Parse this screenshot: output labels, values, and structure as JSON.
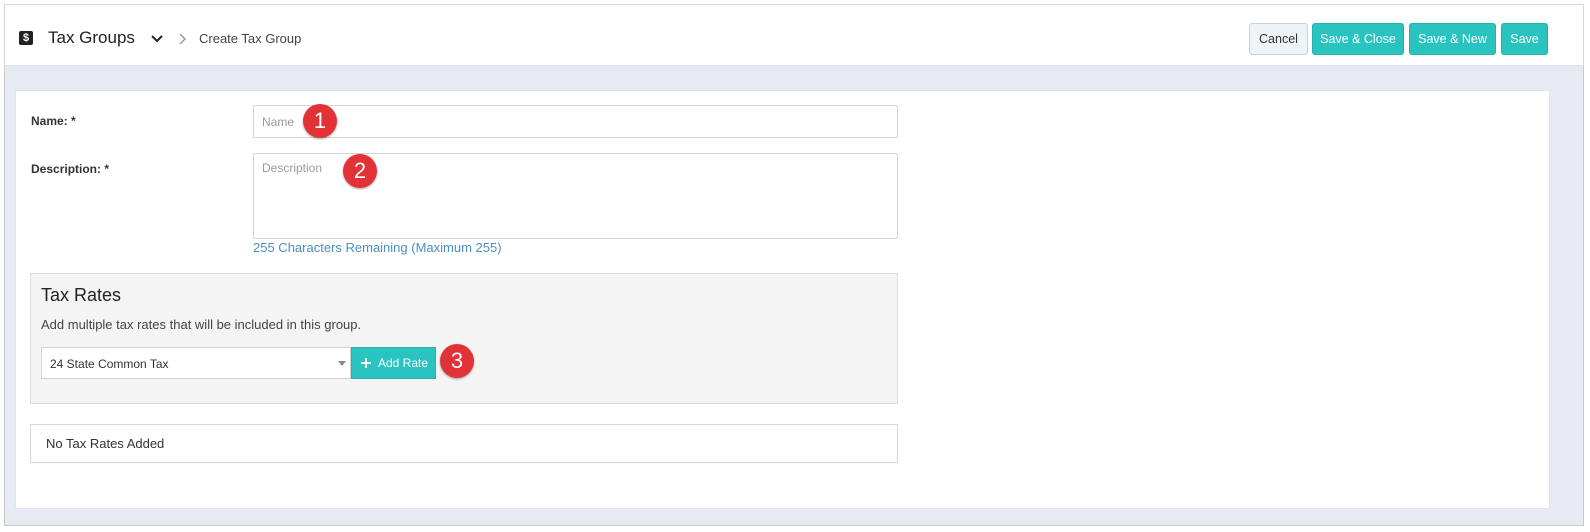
{
  "header": {
    "module_icon": "$",
    "module_title": "Tax Groups",
    "breadcrumb_current": "Create Tax Group",
    "buttons": {
      "cancel": "Cancel",
      "save_close": "Save & Close",
      "save_new": "Save & New",
      "save": "Save"
    }
  },
  "form": {
    "name": {
      "label": "Name: *",
      "value": "",
      "placeholder": "Name"
    },
    "description": {
      "label": "Description: *",
      "value": "",
      "placeholder": "Description",
      "remaining": "255 Characters Remaining (Maximum 255)"
    }
  },
  "tax_rates": {
    "title": "Tax Rates",
    "hint": "Add multiple tax rates that will be included in this group.",
    "selected_rate": "24 State Common Tax",
    "add_button": "Add Rate",
    "empty_message": "No Tax Rates Added"
  },
  "markers": [
    "1",
    "2",
    "3"
  ],
  "colors": {
    "accent": "#29c3c0",
    "marker": "#e13237",
    "link": "#4a8fc0"
  }
}
